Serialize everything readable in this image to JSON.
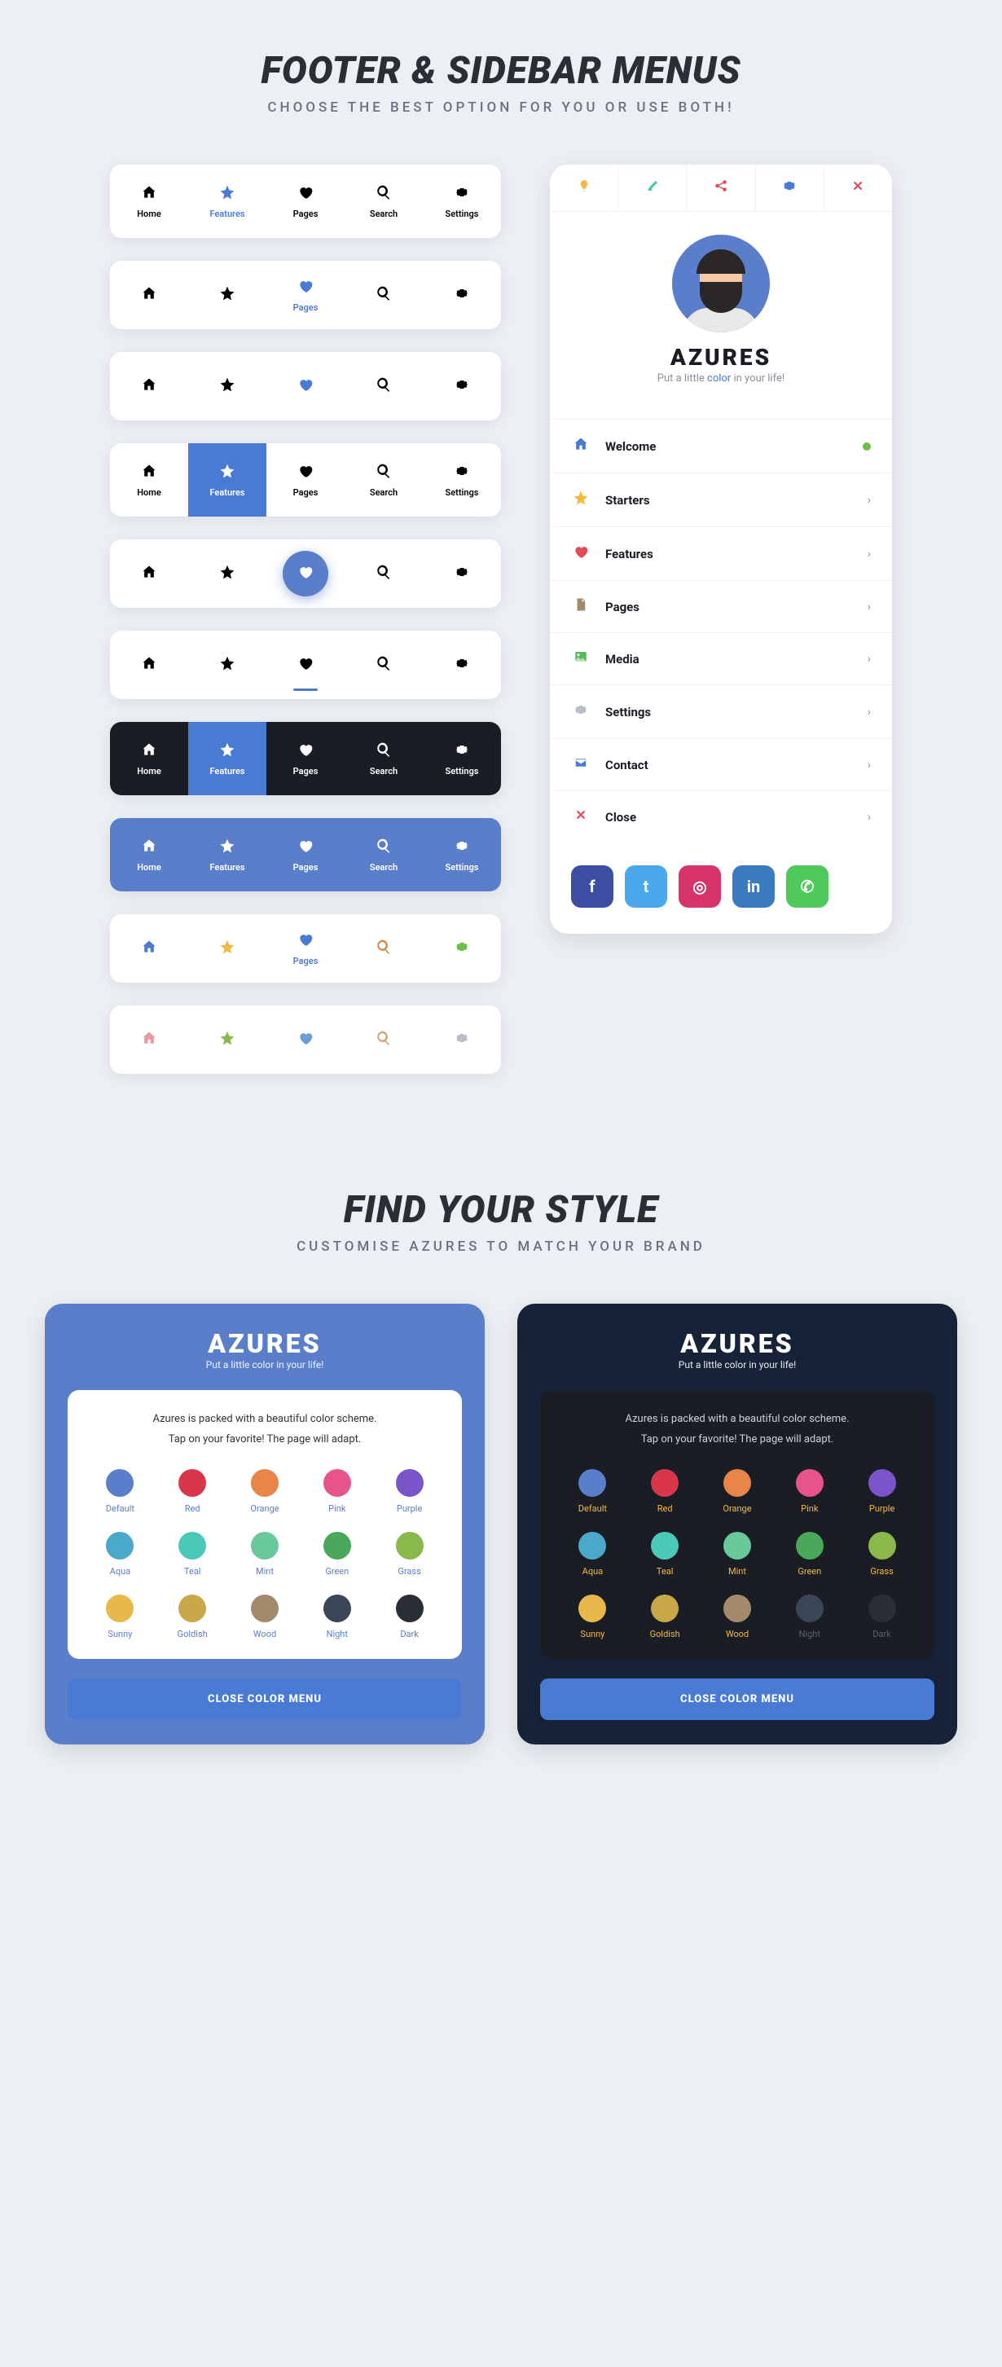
{
  "section1": {
    "title": "FOOTER & SIDEBAR MENUS",
    "subtitle": "CHOOSE THE BEST OPTION FOR YOU OR USE BOTH!"
  },
  "footer_items": {
    "home": "Home",
    "features": "Features",
    "pages": "Pages",
    "search": "Search",
    "settings": "Settings"
  },
  "sidebar": {
    "name": "AZURES",
    "tag_pre": "Put a little ",
    "tag_color": "color",
    "tag_post": " in your life!",
    "top_icons": [
      "bulb",
      "brush",
      "share",
      "gear",
      "close"
    ],
    "menu": [
      {
        "icon": "home",
        "label": "Welcome",
        "color": "#4a7bd4",
        "end": "dot"
      },
      {
        "icon": "star",
        "label": "Starters",
        "color": "#f5b941",
        "end": "chev"
      },
      {
        "icon": "heart",
        "label": "Features",
        "color": "#e34a5a",
        "end": "chev"
      },
      {
        "icon": "file",
        "label": "Pages",
        "color": "#a38a6d",
        "end": "chev"
      },
      {
        "icon": "image",
        "label": "Media",
        "color": "#5cb85c",
        "end": "chev"
      },
      {
        "icon": "gear",
        "label": "Settings",
        "color": "#b8bec8",
        "end": "chev"
      },
      {
        "icon": "mail",
        "label": "Contact",
        "color": "#4a7bd4",
        "end": "chev"
      },
      {
        "icon": "close",
        "label": "Close",
        "color": "#e34a5a",
        "end": "chev"
      }
    ],
    "social": [
      {
        "name": "facebook",
        "glyph": "f",
        "bg": "#3b4ea3"
      },
      {
        "name": "twitter",
        "glyph": "t",
        "bg": "#4aa8ec"
      },
      {
        "name": "instagram",
        "glyph": "◎",
        "bg": "#d6336c"
      },
      {
        "name": "linkedin",
        "glyph": "in",
        "bg": "#3a7bbf"
      },
      {
        "name": "whatsapp",
        "glyph": "✆",
        "bg": "#4ec95c"
      }
    ]
  },
  "section2": {
    "title": "FIND YOUR STYLE",
    "subtitle": "CUSTOMISE AZURES TO MATCH YOUR BRAND"
  },
  "style_card": {
    "title": "AZURES",
    "sub": "Put a little color in your life!",
    "desc1": "Azures is packed with a beautiful color scheme.",
    "desc2": "Tap on your favorite! The page will adapt.",
    "close": "CLOSE COLOR MENU",
    "colors": [
      {
        "name": "Default",
        "hex": "#5a7ec9"
      },
      {
        "name": "Red",
        "hex": "#d9364a"
      },
      {
        "name": "Orange",
        "hex": "#e8864a"
      },
      {
        "name": "Pink",
        "hex": "#e8548a"
      },
      {
        "name": "Purple",
        "hex": "#7a54c9"
      },
      {
        "name": "Aqua",
        "hex": "#4aa8c9"
      },
      {
        "name": "Teal",
        "hex": "#4ac9b8"
      },
      {
        "name": "Mint",
        "hex": "#6ac99a"
      },
      {
        "name": "Green",
        "hex": "#4aa85a"
      },
      {
        "name": "Grass",
        "hex": "#8ab84a"
      },
      {
        "name": "Sunny",
        "hex": "#e8b84a"
      },
      {
        "name": "Goldish",
        "hex": "#c9a84a"
      },
      {
        "name": "Wood",
        "hex": "#a38a6d"
      },
      {
        "name": "Night",
        "hex": "#3a4558"
      },
      {
        "name": "Dark",
        "hex": "#2a2f36"
      }
    ]
  }
}
